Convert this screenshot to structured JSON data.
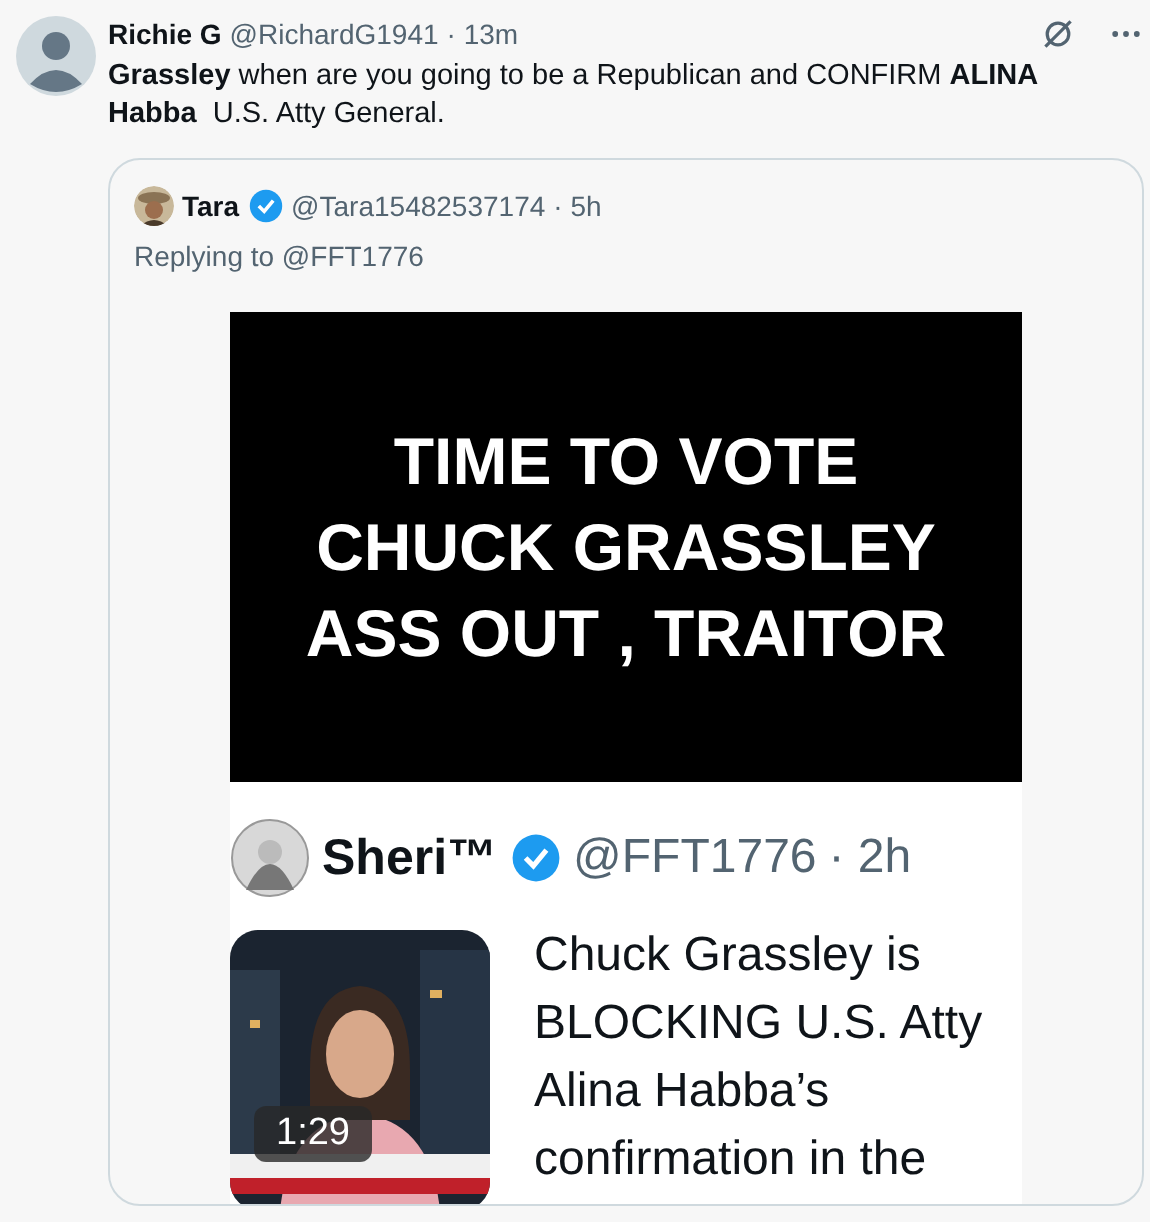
{
  "tweet": {
    "author": "Richie G",
    "handle": "@RichardG1941",
    "time": "· 13m",
    "text": "**Grassley** when are you going to be a Republican and CONFIRM **ALINA Habba**  U.S. Atty General."
  },
  "quote": {
    "author": "Tara",
    "verified": true,
    "handle": "@Tara15482537174",
    "time": "· 5h",
    "replying_to": "Replying to @FFT1776",
    "image": {
      "headline": "TIME TO VOTE\nCHUCK GRASSLEY\nASS OUT , TRAITOR",
      "post": {
        "author": "Sheri™",
        "verified": true,
        "handle": "@FFT1776",
        "time": "· 2h",
        "video_duration": "1:29",
        "text": "Chuck Grassley is\nBLOCKING U.S. Atty\nAlina Habba’s\nconfirmation in the"
      }
    }
  }
}
